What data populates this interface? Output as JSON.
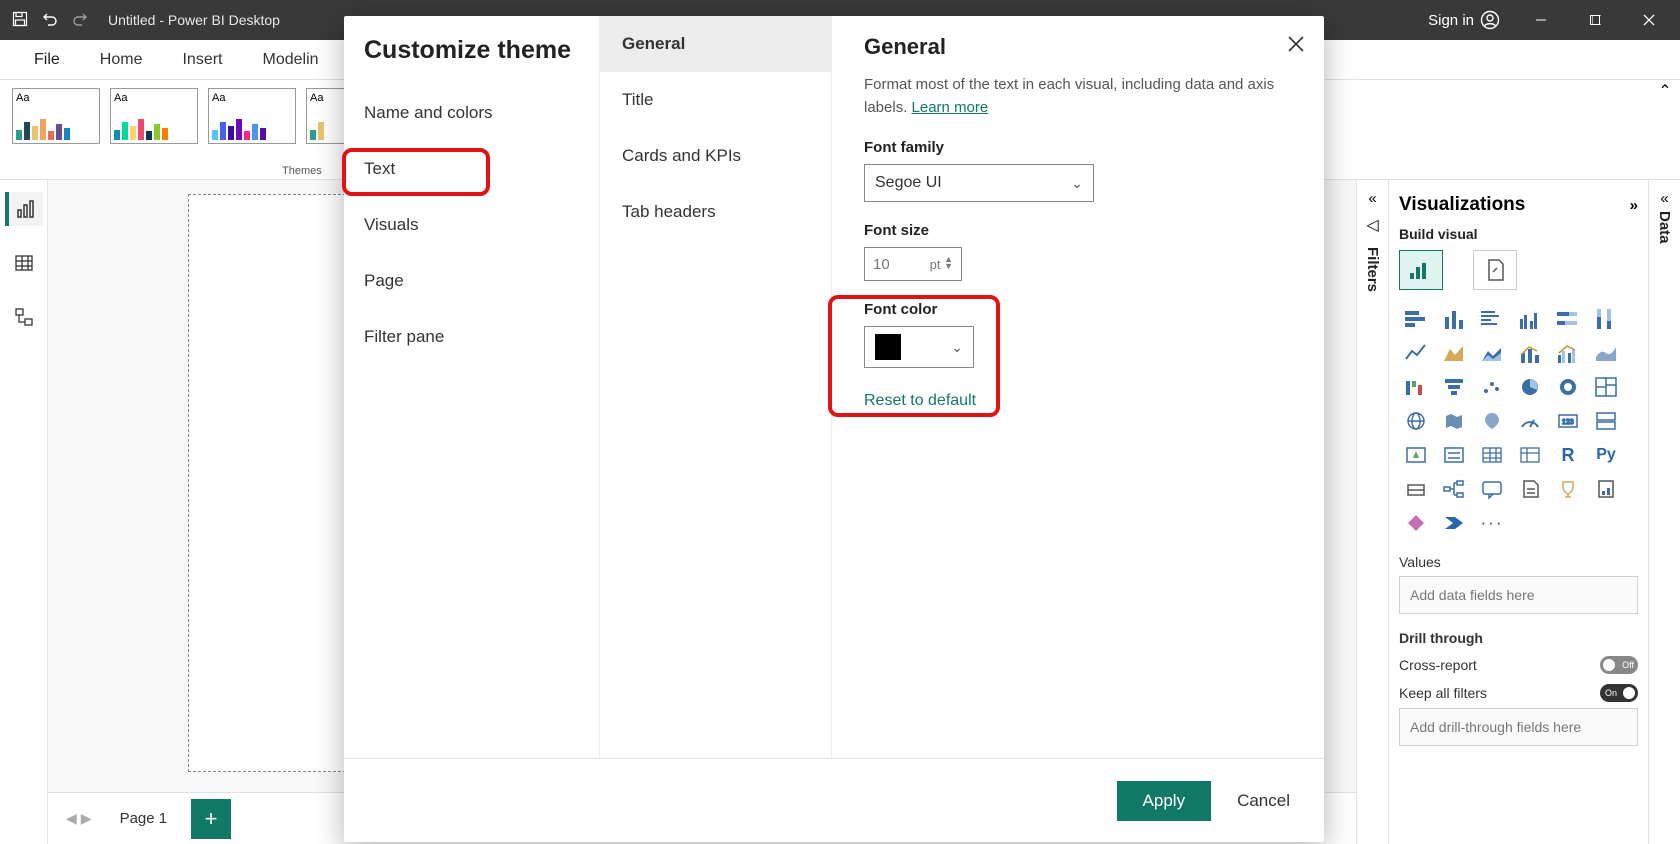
{
  "titlebar": {
    "title": "Untitled - Power BI Desktop",
    "signin": "Sign in"
  },
  "ribbon": {
    "tabs": [
      "File",
      "Home",
      "Insert",
      "Modelin"
    ],
    "themes_label": "Themes"
  },
  "leftrail": {
    "items": [
      "report",
      "data",
      "model"
    ]
  },
  "pages": {
    "page1": "Page 1"
  },
  "filters": {
    "label": "Filters"
  },
  "vis": {
    "header": "Visualizations",
    "sub": "Build visual",
    "values_label": "Values",
    "values_placeholder": "Add data fields here",
    "drill_label": "Drill through",
    "cross_label": "Cross-report",
    "cross_state": "Off",
    "keep_label": "Keep all filters",
    "keep_state": "On",
    "drill_placeholder": "Add drill-through fields here"
  },
  "data_panel": {
    "label": "Data"
  },
  "modal": {
    "title": "Customize theme",
    "col1": {
      "name_colors": "Name and colors",
      "text": "Text",
      "visuals": "Visuals",
      "page": "Page",
      "filter": "Filter pane"
    },
    "col2": {
      "general": "General",
      "title": "Title",
      "cards": "Cards and KPIs",
      "tabs": "Tab headers"
    },
    "col3": {
      "heading": "General",
      "desc": "Format most of the text in each visual, including data and axis labels.  ",
      "learn": "Learn more",
      "font_family_label": "Font family",
      "font_family_value": "Segoe UI",
      "font_size_label": "Font size",
      "font_size_value": "10",
      "font_size_unit": "pt",
      "font_color_label": "Font color",
      "reset": "Reset to default"
    },
    "apply": "Apply",
    "cancel": "Cancel"
  }
}
